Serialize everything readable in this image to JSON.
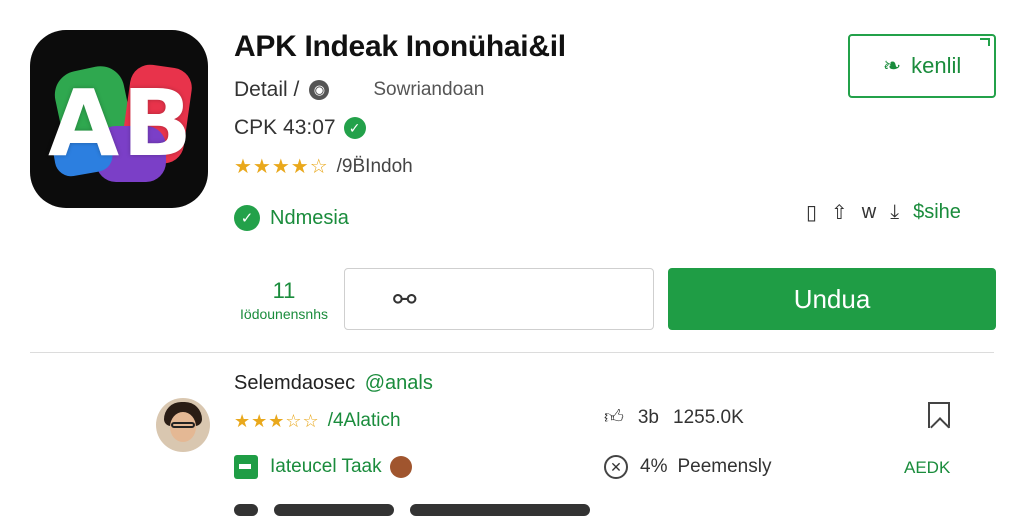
{
  "app": {
    "icon_letters": "AB",
    "title": "APK Indeak Inonühai&il",
    "detail_label": "Detail /",
    "developer_subtitle": "Sowriandoan",
    "version": "CPK 43:07",
    "rating_text": "/9B̈Indoh",
    "status": "Ndmesia"
  },
  "header_actions": {
    "share_label": "kenlil",
    "share_count": "w",
    "download_count": "$sihe"
  },
  "install": {
    "count": "11",
    "count_label": "Iödounensnhs"
  },
  "link_box": {
    "value": ""
  },
  "download_button": {
    "label": "Undua"
  },
  "review": {
    "author": "Selemdaosec",
    "handle": "@anals",
    "rating_text": "/4Alatich",
    "like_count": "3b",
    "like_total": "1255.0K",
    "tag_text": "Iateucel Taak",
    "reply_count": "4%",
    "reply_text": "Peemensly",
    "report_label": "AEDK"
  },
  "colors": {
    "accent_green": "#1f9d45",
    "star_gold": "#e9a81c"
  },
  "icons": {
    "developer": "globe-icon",
    "verified": "check-icon",
    "share": "leaf-icon",
    "link": "link-icon"
  }
}
